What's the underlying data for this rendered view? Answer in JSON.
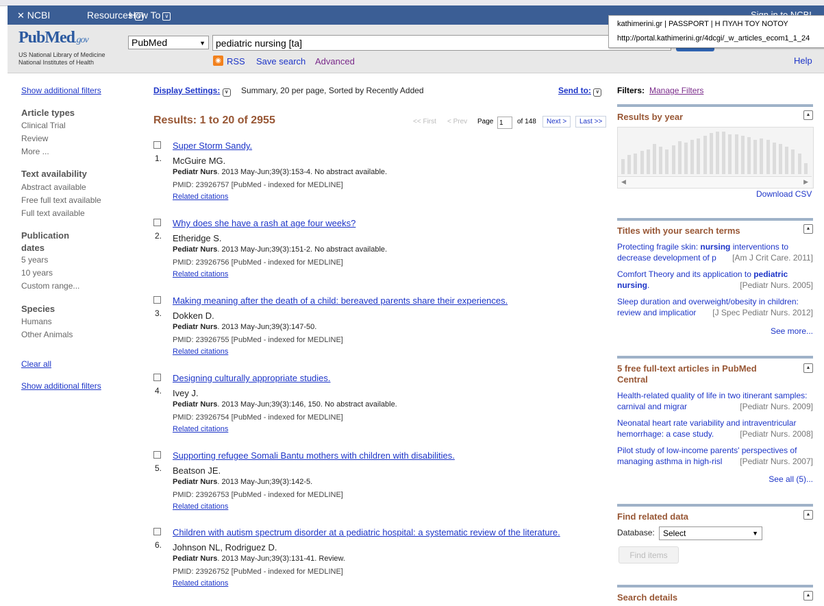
{
  "header": {
    "ncbi": "NCBI",
    "resources": "Resources",
    "how_to": "How To",
    "sign_in": "Sign in to NCBI"
  },
  "logo": {
    "pub": "PubMed",
    "gov": ".gov",
    "line1": "US National Library of Medicine",
    "line2": "National Institutes of Health"
  },
  "search": {
    "database": "PubMed",
    "query": "pediatric nursing [ta]",
    "rss": "RSS",
    "save_search": "Save search",
    "advanced": "Advanced",
    "help": "Help"
  },
  "tooltip": {
    "title": "kathimerini.gr | PASSPORT | Η ΠΥΛΗ ΤΟΥ ΝΟΤΟΥ",
    "url": "http://portal.kathimerini.gr/4dcgi/_w_articles_ecom1_1_24"
  },
  "filters": {
    "show_additional": "Show additional filters",
    "article_types": "Article types",
    "clinical_trial": "Clinical Trial",
    "review": "Review",
    "more": "More ...",
    "text_availability": "Text availability",
    "abstract_available": "Abstract available",
    "free_full_text": "Free full text available",
    "full_text": "Full text available",
    "publication_dates_1": "Publication",
    "publication_dates_2": "dates",
    "years5": "5 years",
    "years10": "10 years",
    "custom_range": "Custom range...",
    "species": "Species",
    "humans": "Humans",
    "other_animals": "Other Animals",
    "clear_all": "Clear all",
    "show_additional_bottom": "Show additional filters"
  },
  "display": {
    "settings_label": "Display Settings:",
    "summary": "Summary, 20 per page, Sorted by Recently Added",
    "send_to": "Send to:"
  },
  "results": {
    "title": "Results: 1 to 20 of 2955",
    "first": "<< First",
    "prev": "< Prev",
    "page_label": "Page",
    "page_value": "1",
    "of_pages": "of 148",
    "next": "Next >",
    "last": "Last >>",
    "items": [
      {
        "num": "1.",
        "title": "Super Storm Sandy.",
        "authors": "McGuire MG.",
        "journal": "Pediatr Nurs",
        "cit": ". 2013 May-Jun;39(3):153-4. No abstract available.",
        "pmid": "PMID: 23926757 [PubMed - indexed for MEDLINE]",
        "related": "Related citations"
      },
      {
        "num": "2.",
        "title": "Why does she have a rash at age four weeks?",
        "authors": "Etheridge S.",
        "journal": "Pediatr Nurs",
        "cit": ". 2013 May-Jun;39(3):151-2. No abstract available.",
        "pmid": "PMID: 23926756 [PubMed - indexed for MEDLINE]",
        "related": "Related citations"
      },
      {
        "num": "3.",
        "title": "Making meaning after the death of a child: bereaved parents share their experiences.",
        "authors": "Dokken D.",
        "journal": "Pediatr Nurs",
        "cit": ". 2013 May-Jun;39(3):147-50.",
        "pmid": "PMID: 23926755 [PubMed - indexed for MEDLINE]",
        "related": "Related citations"
      },
      {
        "num": "4.",
        "title": "Designing culturally appropriate studies.",
        "authors": "Ivey J.",
        "journal": "Pediatr Nurs",
        "cit": ". 2013 May-Jun;39(3):146, 150. No abstract available.",
        "pmid": "PMID: 23926754 [PubMed - indexed for MEDLINE]",
        "related": "Related citations"
      },
      {
        "num": "5.",
        "title": "Supporting refugee Somali Bantu mothers with children with disabilities.",
        "authors": "Beatson JE.",
        "journal": "Pediatr Nurs",
        "cit": ". 2013 May-Jun;39(3):142-5.",
        "pmid": "PMID: 23926753 [PubMed - indexed for MEDLINE]",
        "related": "Related citations"
      },
      {
        "num": "6.",
        "title": "Children with autism spectrum disorder at a pediatric hospital: a systematic review of the literature.",
        "authors": "Johnson NL, Rodriguez D.",
        "journal": "Pediatr Nurs",
        "cit": ". 2013 May-Jun;39(3):131-41. Review.",
        "pmid": "PMID: 23926752 [PubMed - indexed for MEDLINE]",
        "related": "Related citations"
      }
    ]
  },
  "right": {
    "filters_label": "Filters:",
    "manage_filters": "Manage Filters",
    "results_by_year": "Results by year",
    "download_csv": "Download CSV",
    "year_counts": [
      22,
      28,
      30,
      34,
      36,
      44,
      40,
      36,
      42,
      48,
      46,
      50,
      52,
      56,
      60,
      62,
      62,
      58,
      58,
      56,
      54,
      50,
      52,
      50,
      46,
      44,
      40,
      36,
      30,
      16
    ],
    "titles_head": "Titles with your search terms",
    "titles": [
      {
        "pre": "Protecting fragile skin: ",
        "bold": "nursing",
        "post": " interventions to decrease development of p",
        "src": "[Am J Crit Care. 2011]"
      },
      {
        "pre": "Comfort Theory and its application to ",
        "bold": "pediatric nursing",
        "post": ".",
        "src": "[Pediatr Nurs. 2005]"
      },
      {
        "pre": "Sleep duration and overweight/obesity in children: review and implicatior",
        "bold": "",
        "post": "",
        "src": "[J Spec Pediatr Nurs. 2012]"
      }
    ],
    "see_more": "See more...",
    "free_head_1": "5 free full-text articles in PubMed",
    "free_head_2": "Central",
    "free": [
      {
        "text": "Health-related quality of life in two itinerant samples: carnival and migrar",
        "src": "[Pediatr Nurs. 2009]"
      },
      {
        "text": "Neonatal heart rate variability and intraventricular hemorrhage: a case study.",
        "src": "[Pediatr Nurs. 2008]"
      },
      {
        "text": "Pilot study of low-income parents' perspectives of managing asthma in high-risl",
        "src": "[Pediatr Nurs. 2007]"
      }
    ],
    "see_all": "See all (5)...",
    "find_related": "Find related data",
    "database_label": "Database:",
    "database_value": "Select",
    "find_items": "Find items",
    "search_details": "Search details"
  }
}
